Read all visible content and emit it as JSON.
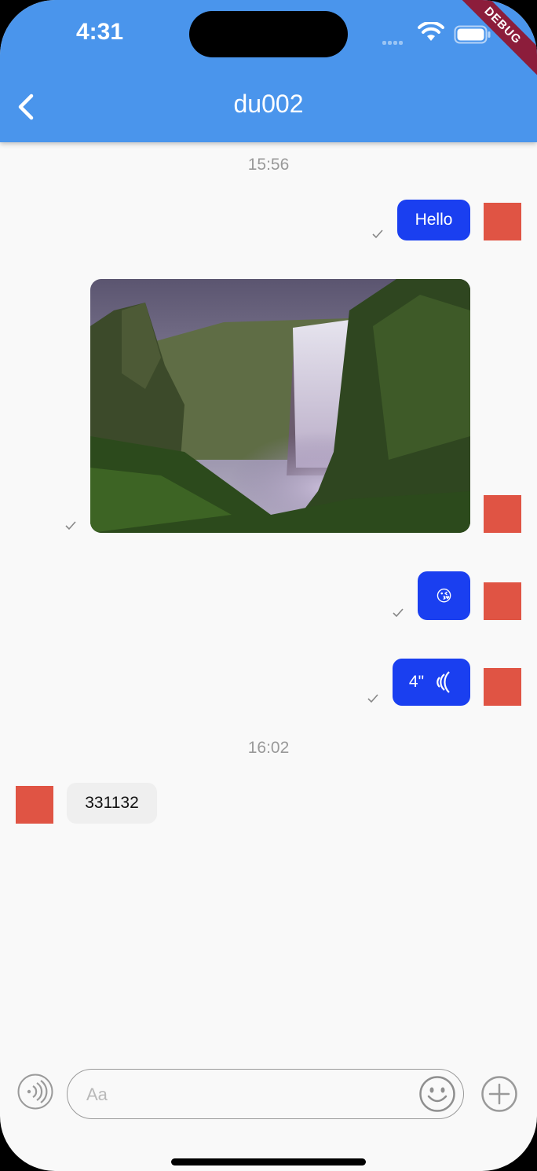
{
  "status": {
    "time": "4:31",
    "debug_label": "DEBUG"
  },
  "header": {
    "title": "du002",
    "back_icon": "chevron-left-icon"
  },
  "colors": {
    "appbar": "#4a95ec",
    "outgoing_bubble": "#1a3ff0",
    "avatar": "#e05444",
    "incoming_bubble": "#efefef"
  },
  "messages": {
    "time_1": "15:56",
    "hello": "Hello",
    "emoji": "😘",
    "voice": "4\"",
    "time_2": "16:02",
    "incoming_text": "331132"
  },
  "input": {
    "placeholder": "Aa"
  }
}
